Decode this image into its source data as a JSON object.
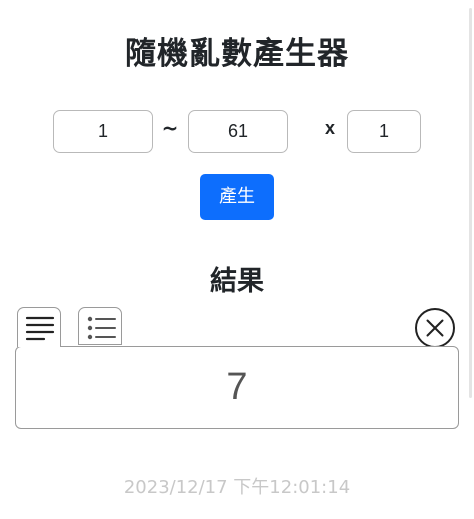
{
  "page": {
    "title": "隨機亂數產生器"
  },
  "range": {
    "min_value": "1",
    "separator": "~",
    "max_value": "61",
    "times_symbol": "x",
    "count_value": "1"
  },
  "generate_button": {
    "label": "產生"
  },
  "result": {
    "heading": "結果",
    "tabs": [
      {
        "icon": "text-lines-icon",
        "active": true
      },
      {
        "icon": "bullet-list-icon",
        "active": false
      }
    ],
    "close_icon": "circle-x-icon",
    "value": "7",
    "timestamp": "2023/12/17 下午12:01:14"
  },
  "colors": {
    "accent": "#0d6efd",
    "border": "#9a9a9a",
    "timestamp": "#c8c8c8"
  }
}
